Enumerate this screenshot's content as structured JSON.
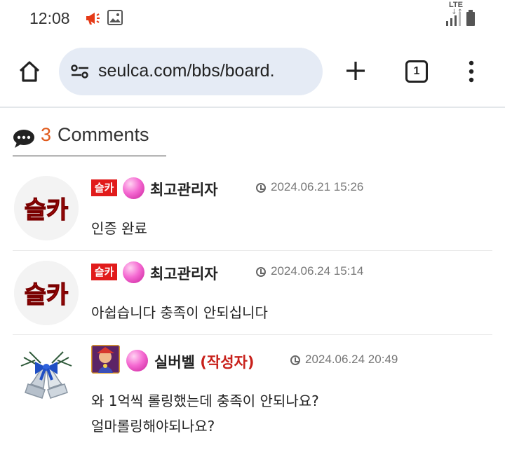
{
  "status_bar": {
    "time": "12:08",
    "network": "LTE",
    "icons": [
      "megaphone-icon",
      "image-icon",
      "signal-icon",
      "battery-icon"
    ]
  },
  "browser": {
    "url": "seulca.com/bbs/board.",
    "tab_count": "1",
    "icons": [
      "home-icon",
      "site-settings-icon",
      "new-tab-icon",
      "more-icon"
    ]
  },
  "comments_section": {
    "count": "3",
    "label": "Comments",
    "icon": "speech-bubble-icon"
  },
  "comments": [
    {
      "level_badge": "슬카",
      "nickname": "최고관리자",
      "author_tag": "",
      "date": "2024.06.21 15:26",
      "lines": [
        "인증 완료"
      ]
    },
    {
      "level_badge": "슬카",
      "nickname": "최고관리자",
      "author_tag": "",
      "date": "2024.06.24 15:14",
      "lines": [
        "아쉽습니다 충족이 안되십니다"
      ]
    },
    {
      "level_badge": "",
      "nickname": "실버벨",
      "author_tag": "(작성자)",
      "date": "2024.06.24 20:49",
      "lines": [
        "와 1억씩 롤링했는데 충족이 안되나요?",
        "얼마롤링해야되나요?"
      ]
    }
  ],
  "avatar_logo_text": "슬카",
  "colors": {
    "accent": "#e05a1c",
    "brand_red": "#e11b1b",
    "author": "#c8211b",
    "urlbar": "#e5ebf5"
  }
}
